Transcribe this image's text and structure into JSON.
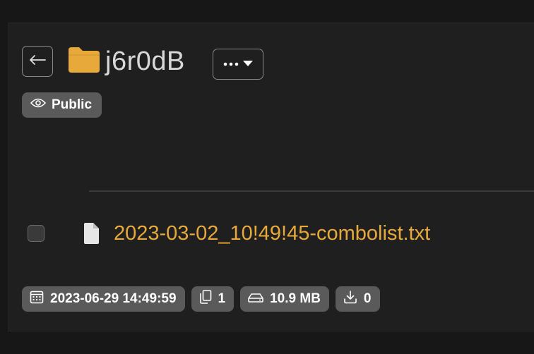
{
  "folder": {
    "name": "j6r0dB",
    "visibility": "Public"
  },
  "icons": {
    "back": "arrow-left-icon",
    "folder": "folder-icon",
    "more": "ellipsis-icon",
    "dropdown": "caret-down-icon",
    "visibility": "eye-icon",
    "file": "document-icon",
    "date": "calendar-icon",
    "count": "files-icon",
    "size": "drive-icon",
    "downloads": "download-icon"
  },
  "colors": {
    "folder": "#e8a93b",
    "file_name": "#e8a93b",
    "badge_bg": "#5a5a5a"
  },
  "files": [
    {
      "name": "2023-03-02_10!49!45-combolist.txt"
    }
  ],
  "meta": {
    "date": "2023-06-29 14:49:59",
    "file_count": "1",
    "size": "10.9 MB",
    "downloads": "0"
  }
}
